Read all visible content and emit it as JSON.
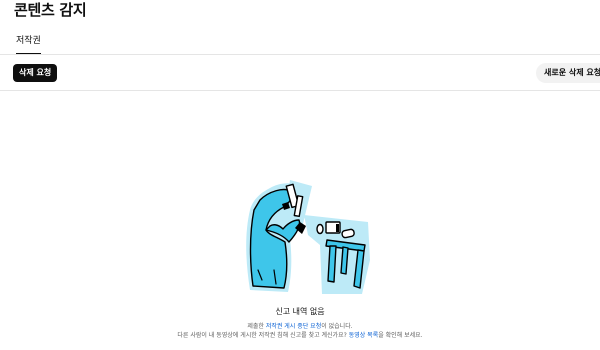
{
  "page": {
    "title": "콘텐츠 감지"
  },
  "tabs": [
    {
      "label": "저작권",
      "selected": true
    }
  ],
  "toolbar": {
    "delete_request_label": "삭제 요청",
    "new_delete_request_label": "새로운 삭제 요청"
  },
  "empty_state": {
    "title": "신고 내역 없음",
    "line1_before": "제출한 ",
    "line1_link": "저작권 게시 중단 요청",
    "line1_after": "이 없습니다.",
    "line2_before": "다른 사람이 내 동영상에 게시한 저작권 침해 신고를 찾고 계신가요? ",
    "line2_link": "동영상 목록",
    "line2_after": "을 확인해 보세요."
  },
  "colors": {
    "accent_link": "#065fd4",
    "illustration_fill": "#3ec6ea",
    "illustration_halo": "#bdeaf7",
    "primary_button": "#0f0f0f"
  }
}
